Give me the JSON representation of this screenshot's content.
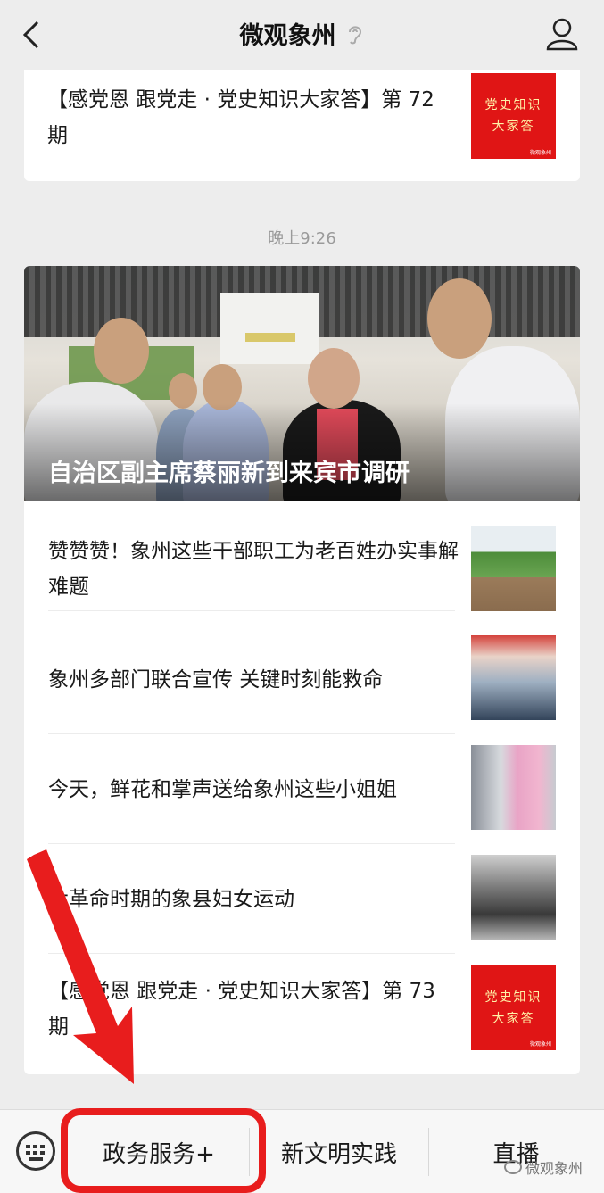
{
  "header": {
    "title": "微观象州"
  },
  "first_card": {
    "title": "【感党恩 跟党走 · 党史知识大家答】第 72 期",
    "thumb": [
      "党史知识",
      "大家答"
    ],
    "thumb_small": "微观象州"
  },
  "timestamp": "晚上9:26",
  "hero": {
    "caption": "自治区副主席蔡丽新到来宾市调研"
  },
  "articles": [
    {
      "title": "赞赞赞！象州这些干部职工为老百姓办实事解难题"
    },
    {
      "title": "象州多部门联合宣传 关键时刻能救命"
    },
    {
      "title": "今天，鲜花和掌声送给象州这些小姐姐"
    },
    {
      "title": "大革命时期的象县妇女运动"
    },
    {
      "title": "【感党恩 跟党走 · 党史知识大家答】第 73 期",
      "thumb": [
        "党史知识",
        "大家答"
      ],
      "thumb_small": "微观象州"
    }
  ],
  "bottom_menu": {
    "items": [
      "政务服务+",
      "新文明实践",
      "直播"
    ],
    "watermark": "微观象州"
  },
  "colors": {
    "highlight": "#e81d1d",
    "thumb_red": "#e01515",
    "background": "#ededed"
  },
  "icons": [
    "back-icon",
    "ear-icon",
    "profile-icon",
    "keyboard-icon"
  ]
}
